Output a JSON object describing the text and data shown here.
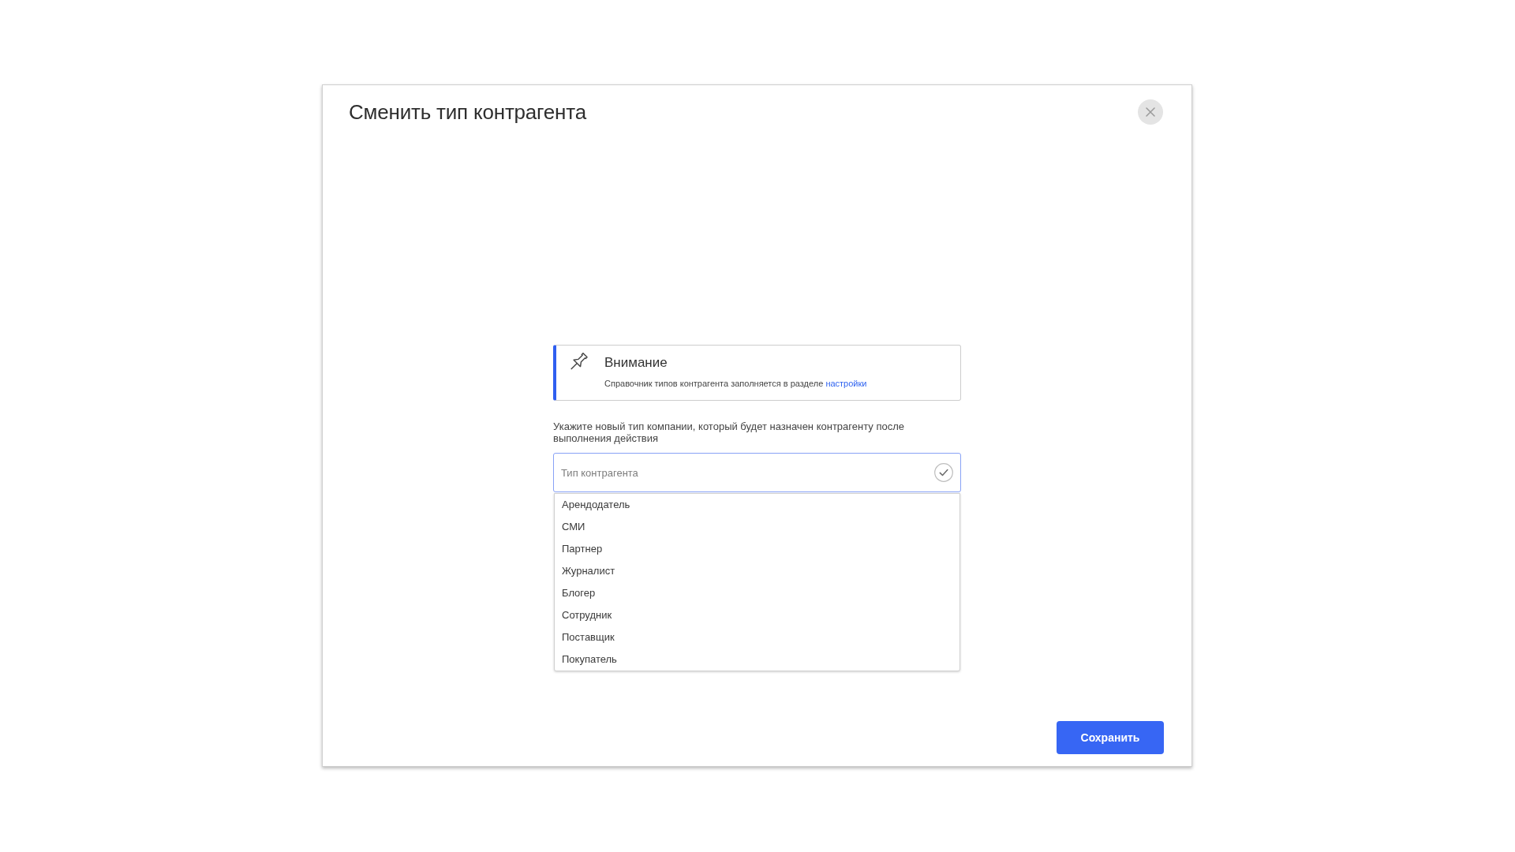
{
  "dialog": {
    "title": "Сменить тип контрагента"
  },
  "notice": {
    "title": "Внимание",
    "text": "Справочник типов контрагента заполняется в разделе",
    "link": "настройки"
  },
  "prompt": "Укажите новый тип компании, который будет назначен контрагенту после выполнения действия",
  "field": {
    "placeholder": "Тип контрагента"
  },
  "dropdown": {
    "options": [
      {
        "label": "Арендодатель",
        "selected": false
      },
      {
        "label": "СМИ",
        "selected": false
      },
      {
        "label": "Партнер",
        "selected": false
      },
      {
        "label": "Журналист",
        "selected": false
      },
      {
        "label": "Блогер",
        "selected": false
      },
      {
        "label": "Сотрудник",
        "selected": false
      },
      {
        "label": "Поставщик",
        "selected": false
      },
      {
        "label": "Покупатель",
        "selected": false
      }
    ]
  },
  "buttons": [
    {
      "label": "Сохранить",
      "kind": "primary"
    }
  ]
}
